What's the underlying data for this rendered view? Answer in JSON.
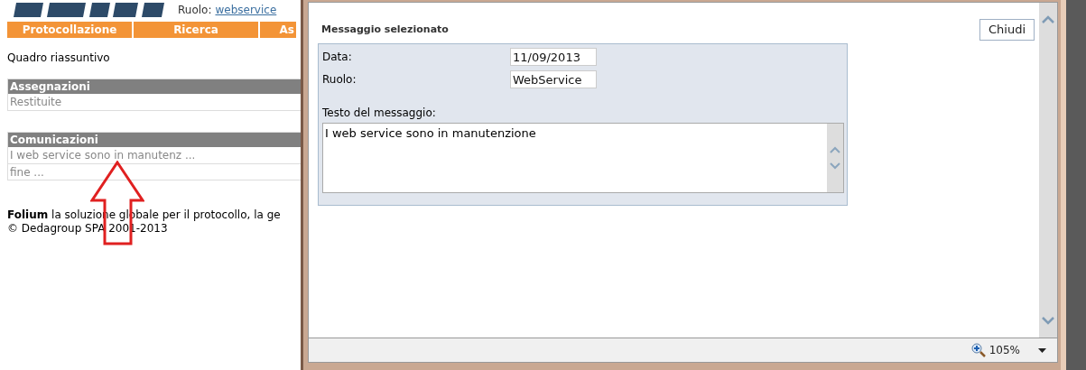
{
  "header": {
    "role_label": "Ruolo:",
    "role_link": "webservice"
  },
  "nav_tabs": [
    {
      "label": "Protocollazione"
    },
    {
      "label": "Ricerca"
    },
    {
      "label": "As"
    }
  ],
  "page_title": "Quadro riassuntivo",
  "sections": [
    {
      "title": "Assegnazioni",
      "items": [
        "Restituite"
      ]
    },
    {
      "title": "Comunicazioni",
      "items": [
        "I web service sono in manutenz ...",
        "fine ..."
      ]
    }
  ],
  "footer": {
    "text": "**Folium** la soluzione globale per il protocollo, la ge",
    "copyright": "© Dedagroup SPA 2001-2013"
  },
  "dialog": {
    "title": "Messaggio selezionato",
    "close_button": "Chiudi",
    "fields": [
      {
        "label": "Data:",
        "value": "11/09/2013"
      },
      {
        "label": "Ruolo:",
        "value": "WebService"
      }
    ],
    "message_label": "Testo del messaggio:",
    "message": "I web service sono in manutenzione",
    "zoom": "105%"
  }
}
